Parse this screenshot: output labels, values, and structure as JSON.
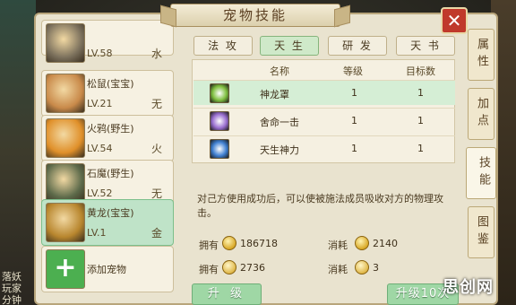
{
  "title": "宠物技能",
  "close_glyph": "✕",
  "pets": [
    {
      "name": "",
      "level": "LV.58",
      "element": "水",
      "selected": false,
      "color": "#7b705c"
    },
    {
      "name": "松鼠(宝宝)",
      "level": "LV.21",
      "element": "无",
      "selected": false,
      "color": "#c98a4a"
    },
    {
      "name": "火鸦(野生)",
      "level": "LV.54",
      "element": "火",
      "selected": false,
      "color": "#e0902a"
    },
    {
      "name": "石魔(野生)",
      "level": "LV.52",
      "element": "无",
      "selected": false,
      "color": "#5d6a4a"
    },
    {
      "name": "黄龙(宝宝)",
      "level": "LV.1",
      "element": "金",
      "selected": true,
      "color": "#b8862e"
    },
    {
      "name": "添加宠物",
      "level": "",
      "element": "",
      "selected": false,
      "color": "#4caf50",
      "add": true
    }
  ],
  "add_glyph": "+",
  "tabs": [
    "法 攻",
    "天 生",
    "研 发",
    "天 书"
  ],
  "active_tab_index": 1,
  "side_tabs": [
    "属性",
    "加点",
    "技能",
    "图鉴"
  ],
  "active_side_tab_index": 2,
  "table": {
    "headers": [
      "名称",
      "等级",
      "目标数"
    ],
    "rows": [
      {
        "name": "神龙罩",
        "level": "1",
        "targets": "1",
        "highlight": true,
        "icon_color": "#7fbf3f"
      },
      {
        "name": "舍命一击",
        "level": "1",
        "targets": "1",
        "highlight": false,
        "icon_color": "#9a6fd0"
      },
      {
        "name": "天生神力",
        "level": "1",
        "targets": "1",
        "highlight": false,
        "icon_color": "#3f7fd0"
      }
    ]
  },
  "description": "对己方使用成功后，可以使被施法成员吸收对方的物理攻击。",
  "resources": {
    "own_label": "拥有",
    "cost_label": "消耗",
    "own_coin": "186718",
    "cost_coin": "2140",
    "own_item": "2736",
    "cost_item": "3"
  },
  "buttons": {
    "upgrade": "升 级",
    "upgrade10": "升级10次"
  },
  "bg_text": "落妖\n玩家\n分钟",
  "watermark": "思创网",
  "colors": {
    "accent_green": "#9fd7a5",
    "close_red": "#c0392b"
  }
}
